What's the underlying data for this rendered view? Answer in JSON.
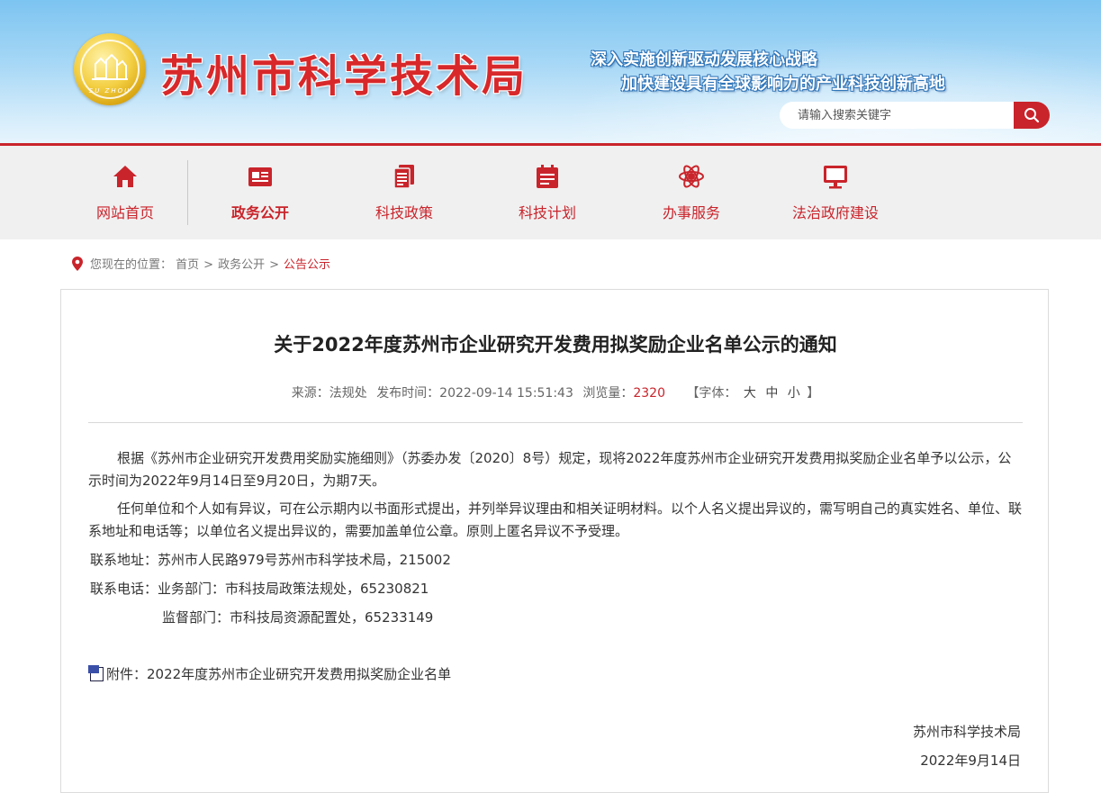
{
  "header": {
    "logo_text": "SU ZHOU",
    "title": "苏州市科学技术局",
    "slogan_line1": "深入实施创新驱动发展核心战略",
    "slogan_line2": "加快建设具有全球影响力的产业科技创新高地",
    "search_placeholder": "请输入搜索关键字",
    "search_icon": "search-icon",
    "accent_color": "#c9242b"
  },
  "nav": {
    "items": [
      {
        "label": "网站首页",
        "icon": "home-icon"
      },
      {
        "label": "政务公开",
        "icon": "newspaper-icon",
        "active": true
      },
      {
        "label": "科技政策",
        "icon": "documents-icon"
      },
      {
        "label": "科技计划",
        "icon": "calendar-icon"
      },
      {
        "label": "办事服务",
        "icon": "atom-icon"
      },
      {
        "label": "法治政府建设",
        "icon": "monitor-icon"
      }
    ]
  },
  "breadcrumb": {
    "prefix": "您现在的位置：",
    "items": [
      "首页",
      "政务公开",
      "公告公示"
    ],
    "separator": ">"
  },
  "article": {
    "title": "关于2022年度苏州市企业研究开发费用拟奖励企业名单公示的通知",
    "source_label": "来源：法规处",
    "date_label": "发布时间：2022-09-14 15:51:43",
    "views_label": "浏览量：",
    "views": "2320",
    "font_label": "【字体：",
    "font_large": "大",
    "font_medium": "中",
    "font_small": "小",
    "font_close": "】",
    "paragraphs": [
      "根据《苏州市企业研究开发费用奖励实施细则》（苏委办发〔2020〕8号）规定，现将2022年度苏州市企业研究开发费用拟奖励企业名单予以公示，公示时间为2022年9月14日至9月20日，为期7天。",
      "任何单位和个人如有异议，可在公示期内以书面形式提出，并列举异议理由和相关证明材料。以个人名义提出异议的，需写明自己的真实姓名、单位、联系地址和电话等；以单位名义提出异议的，需要加盖单位公章。原则上匿名异议不予受理。"
    ],
    "contact_address": "联系地址：苏州市人民路979号苏州市科学技术局，215002",
    "contact_phone": "联系电话：业务部门：市科技局政策法规处，65230821",
    "supervise_phone": "监督部门：市科技局资源配置处，65233149",
    "attachment": "附件：2022年度苏州市企业研究开发费用拟奖励企业名单",
    "attachment_icon": "document-icon",
    "signature_org": "苏州市科学技术局",
    "signature_date": "2022年9月14日"
  }
}
